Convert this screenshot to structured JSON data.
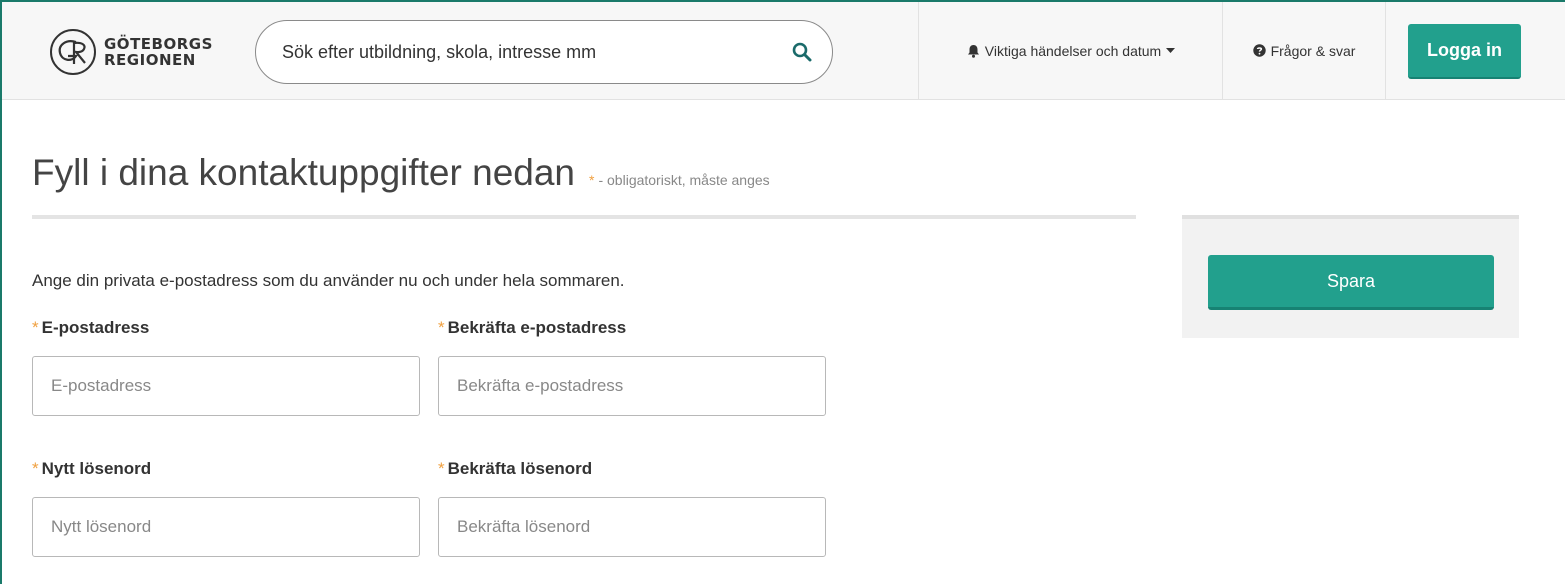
{
  "header": {
    "logo": {
      "line1": "GÖTEBORGS",
      "line2": "REGIONEN"
    },
    "search": {
      "placeholder": "Sök efter utbildning, skola, intresse mm"
    },
    "nav": {
      "events_label": "Viktiga händelser och datum",
      "faq_label": "Frågor & svar"
    },
    "login_label": "Logga in"
  },
  "main": {
    "title": "Fyll i dina kontaktuppgifter nedan",
    "required_star": "*",
    "required_note": "- obligatoriskt, måste anges",
    "intro": "Ange din privata e-postadress som du använder nu och under hela sommaren.",
    "fields": [
      {
        "label": "E-postadress",
        "placeholder": "E-postadress",
        "value": ""
      },
      {
        "label": "Bekräfta e-postadress",
        "placeholder": "Bekräfta e-postadress",
        "value": ""
      },
      {
        "label": "Nytt lösenord",
        "placeholder": "Nytt lösenord",
        "value": ""
      },
      {
        "label": "Bekräfta lösenord",
        "placeholder": "Bekräfta lösenord",
        "value": ""
      }
    ]
  },
  "sidebar": {
    "save_label": "Spara"
  },
  "colors": {
    "accent": "#22a08d",
    "required": "#f0a040",
    "frame": "#1a7a6a"
  },
  "icons": {
    "search": "search-icon",
    "events": "bell-icon",
    "faq": "question-circle-icon",
    "caret": "caret-down-icon"
  }
}
